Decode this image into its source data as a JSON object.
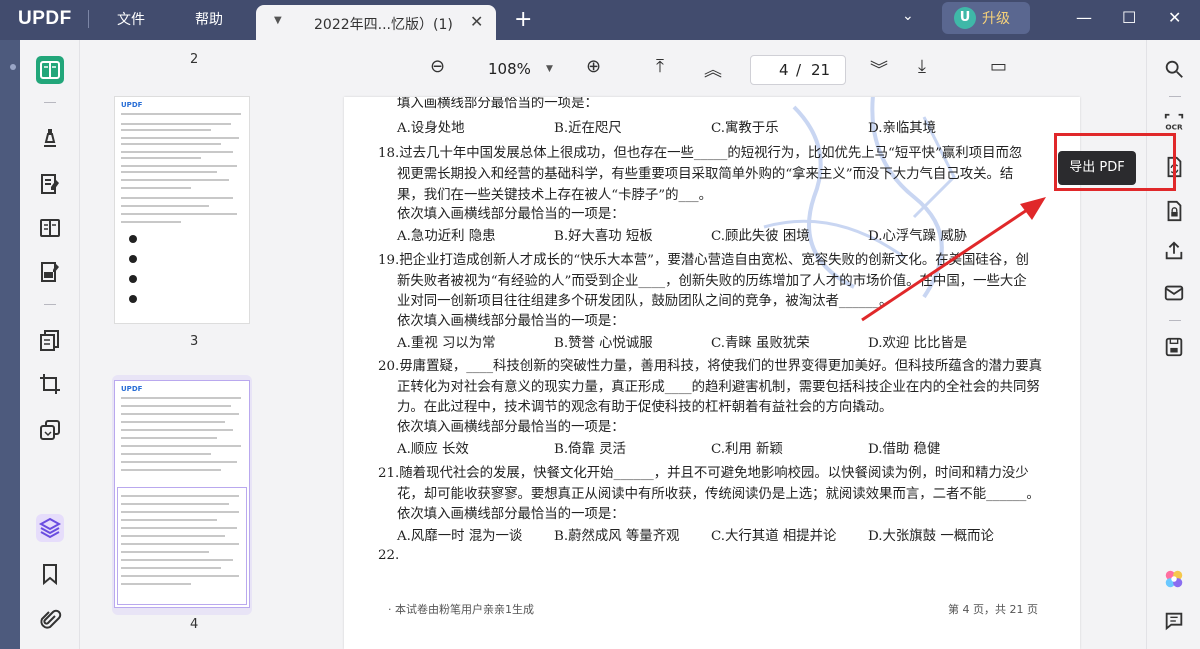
{
  "titlebar": {
    "logo": "UPDF",
    "menu": [
      "文件",
      "帮助"
    ],
    "tab_title": "2022年四...忆版）(1)",
    "upgrade_avatar": "U",
    "upgrade_label": "升级"
  },
  "toolbar": {
    "zoom": "108%",
    "page_current": "4",
    "page_sep": "/",
    "page_total": "21"
  },
  "thumbnails": {
    "labels": [
      "2",
      "3",
      "4"
    ]
  },
  "document": {
    "lines": [
      "填入画横线部分最恰当的一项是：",
      "A.设身处地",
      "B.近在咫尺",
      "C.寓教于乐",
      "D.亲临其境",
      "18.过去几十年中国发展总体上很成功，但也存在一些_____的短视行为，比如优先上马“短平快”赢利项目而忽",
      "视更需长期投入和经营的基础科学，有些重要项目采取简单外购的“拿来主义”而没下大力气自己攻关。结",
      "果，我们在一些关键技术上存在被人“卡脖子”的___。",
      "依次填入画横线部分最恰当的一项是：",
      "A.急功近利 隐患",
      "B.好大喜功 短板",
      "C.顾此失彼 困境",
      "D.心浮气躁 威胁",
      "19.把企业打造成创新人才成长的“快乐大本营”，要潜心营造自由宽松、宽容失败的创新文化。在美国硅谷，创",
      "新失败者被视为“有经验的人”而受到企业____，创新失败的历练增加了人才的市场价值。在中国，一些大企",
      "业对同一创新项目往往组建多个研发团队，鼓励团队之间的竞争，被淘汰者______。",
      "依次填入画横线部分最恰当的一项是：",
      "A.重视 习以为常",
      "B.赞誉 心悦诚服",
      "C.青睐 虽败犹荣",
      "D.欢迎 比比皆是",
      "20.毋庸置疑，____科技创新的突破性力量，善用科技，将使我们的世界变得更加美好。但科技所蕴含的潜力要真",
      "正转化为对社会有意义的现实力量，真正形成____的趋利避害机制，需要包括科技企业在内的全社会的共同努",
      "力。在此过程中，技术调节的观念有助于促使科技的杠杆朝着有益社会的方向撬动。",
      "依次填入画横线部分最恰当的一项是：",
      "A.顺应 长效",
      "B.倚靠 灵活",
      "C.利用 新颖",
      "D.借助 稳健",
      "21.随着现代社会的发展，快餐文化开始______，并且不可避免地影响校园。以快餐阅读为例，时间和精力没少",
      "花，却可能收获寥寥。要想真正从阅读中有所收获，传统阅读仍是上选；就阅读效果而言，二者不能______。",
      "依次填入画横线部分最恰当的一项是：",
      "A.风靡一时 混为一谈",
      "B.蔚然成风 等量齐观",
      "C.大行其道 相提并论",
      "D.大张旗鼓 一概而论",
      "22."
    ],
    "footer_left": "· 本试卷由粉笔用户亲亲1生成",
    "footer_right": "第 4 页，共 21 页"
  },
  "right_panel": {
    "ocr_label": "OCR",
    "tooltip": "导出 PDF"
  },
  "colors": {
    "titlebar": "#424c6e",
    "active_tool": "#22a67a",
    "highlight": "#e0282a",
    "upgrade_text": "#f7d27a"
  }
}
